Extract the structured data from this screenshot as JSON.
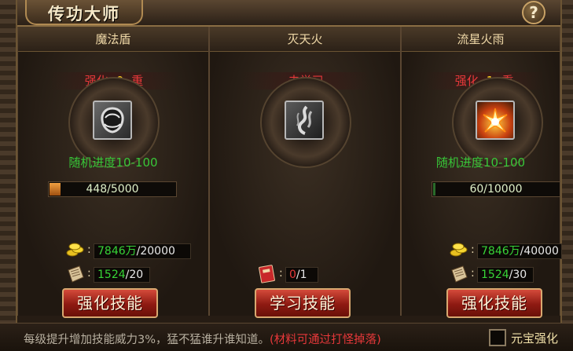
{
  "window": {
    "title": "传功大师",
    "help_label": "?"
  },
  "skills": [
    {
      "name": "魔法盾",
      "status_prefix": "强化",
      "status_level": "0",
      "status_suffix": "重",
      "icon": "magic-shield-icon",
      "progress_text": "随机进度10-100",
      "progress_label": "448/5000",
      "progress_fraction": 0.0896,
      "gold_have": "7846万",
      "gold_need": "/20000",
      "book_have": "1524",
      "book_need": "/20",
      "button_label": "强化技能"
    },
    {
      "name": "灭天火",
      "status_text": "未学习",
      "icon": "sky-fire-icon",
      "book_have": "0",
      "book_need": "/1",
      "button_label": "学习技能"
    },
    {
      "name": "流星火雨",
      "status_prefix": "强化",
      "status_level": "1",
      "status_suffix": "重",
      "icon": "meteor-fire-rain-icon",
      "progress_text": "随机进度10-100",
      "progress_label": "60/10000",
      "progress_fraction": 0.006,
      "gold_have": "7846万",
      "gold_need": "/40000",
      "book_have": "1524",
      "book_need": "/30",
      "button_label": "强化技能"
    }
  ],
  "footer": {
    "info_text": "每级提升增加技能威力3%，猛不猛谁升谁知道。",
    "info_red": "(材料可通过打怪掉落)",
    "checkbox_label": "元宝强化"
  },
  "colors": {
    "status_red": "#e8383a",
    "level_yellow": "#ffd21f",
    "progress_green": "#38c638"
  }
}
